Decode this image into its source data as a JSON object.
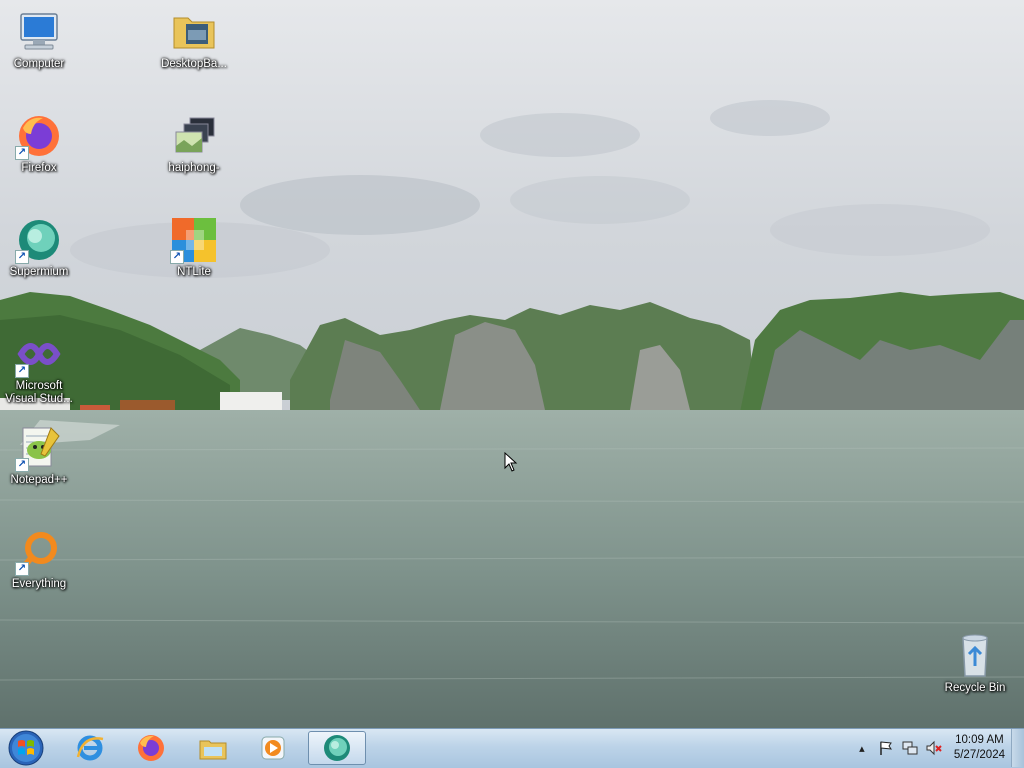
{
  "desktop": {
    "icons": [
      {
        "label": "Computer",
        "icon": "computer-icon"
      },
      {
        "label": "DesktopBa...",
        "icon": "folder-icon"
      },
      {
        "label": "Firefox",
        "icon": "firefox-icon"
      },
      {
        "label": "haiphong-",
        "icon": "image-file-icon"
      },
      {
        "label": "Supermium",
        "icon": "supermium-icon"
      },
      {
        "label": "NTLite",
        "icon": "ntlite-icon"
      },
      {
        "label": "Microsoft Visual Stud...",
        "icon": "visual-studio-icon"
      },
      {
        "label": "Notepad++",
        "icon": "notepadpp-icon"
      },
      {
        "label": "Everything",
        "icon": "everything-icon"
      },
      {
        "label": "Recycle Bin",
        "icon": "recycle-bin-icon"
      }
    ]
  },
  "taskbar": {
    "start": {
      "icon": "windows-orb-icon"
    },
    "pinned": [
      {
        "name": "Internet Explorer",
        "icon": "internet-explorer-icon"
      },
      {
        "name": "Firefox",
        "icon": "firefox-icon"
      },
      {
        "name": "Windows Explorer",
        "icon": "file-explorer-icon"
      },
      {
        "name": "Media Player",
        "icon": "media-player-icon"
      },
      {
        "name": "Supermium",
        "icon": "supermium-icon",
        "active": true
      }
    ],
    "tray": {
      "icons": [
        "show-hidden-icons-arrow",
        "action-center-flag-icon",
        "network-icon",
        "volume-muted-icon"
      ],
      "time": "10:09 AM",
      "date": "5/27/2024"
    }
  },
  "colors": {
    "taskbar_top": "#d9e7f3",
    "taskbar_bottom": "#a9c5df",
    "icon_label_text": "#ffffff"
  }
}
